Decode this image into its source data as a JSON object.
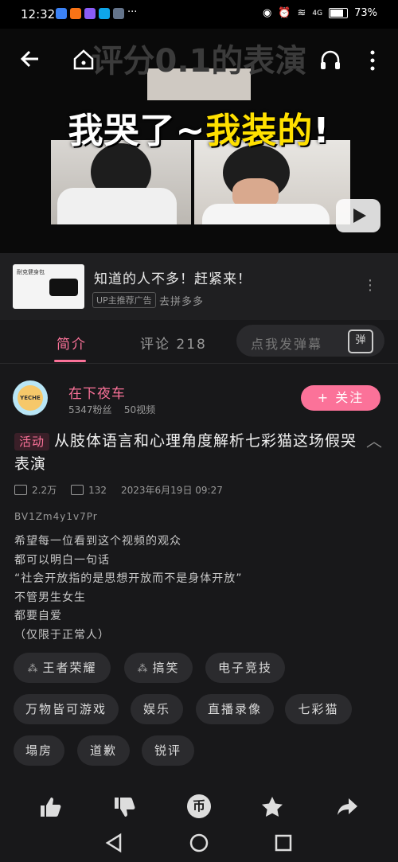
{
  "status_bar": {
    "time": "12:32",
    "more": "···",
    "network": "4G",
    "battery": "73%"
  },
  "video": {
    "overlay_title": "评分0.1的表演",
    "caption_white_1": "我哭了~",
    "caption_yellow": "我装的",
    "caption_white_2": "!"
  },
  "ad": {
    "title": "知道的人不多！赶紧来！",
    "badge": "UP主推荐广告",
    "link": "去拼多多",
    "thumb_text": "耐克健身包"
  },
  "tabs": {
    "intro": "简介",
    "comments": "评论 218",
    "danmaku_placeholder": "点我发弹幕",
    "danmaku_icon": "弹"
  },
  "uploader": {
    "name": "在下夜车",
    "fans": "5347粉丝",
    "videos": "50视频",
    "follow": "+ 关注",
    "avatar_text": "YECHE"
  },
  "video_info": {
    "activity_tag": "活动",
    "title": "从肢体语言和心理角度解析七彩猫这场假哭表演",
    "views": "2.2万",
    "danmaku_count": "132",
    "date": "2023年6月19日 09:27",
    "bvid": "BV1Zm4y1v7Pr",
    "description": [
      "希望每一位看到这个视频的观众",
      "都可以明白一句话",
      "“社会开放指的是思想开放而不是身体开放”",
      "不管男生女生",
      "都要自爱",
      "（仅限于正常人）"
    ]
  },
  "tags": [
    "王者荣耀",
    "搞笑",
    "电子竞技",
    "万物皆可游戏",
    "娱乐",
    "直播录像",
    "七彩猫",
    "塌房",
    "道歉",
    "锐评"
  ],
  "colors": {
    "accent": "#fb7299",
    "background": "#18181a"
  }
}
